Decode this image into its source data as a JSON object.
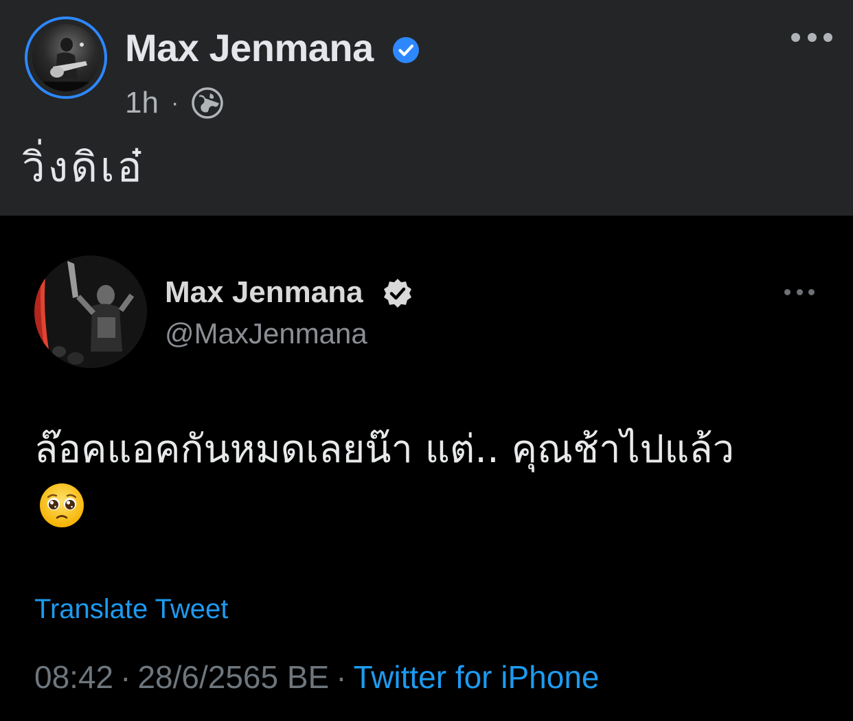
{
  "fb_post": {
    "author_name": "Max Jenmana",
    "time_ago": "1h",
    "separator": "·",
    "caption": "วิ่งดิเอ๋",
    "colors": {
      "background": "#242526",
      "verified": "#2d88ff",
      "avatar_ring": "#2d88ff"
    },
    "icons": {
      "verified": "verified-badge-icon",
      "privacy": "globe-icon",
      "more": "more-options-icon"
    }
  },
  "tweet": {
    "author_name": "Max Jenmana",
    "handle": "@MaxJenmana",
    "text": "ล๊อคแอคกันหมดเลยน๊า แต่.. คุณช้าไปแล้ว",
    "emoji": "pleading-face-icon",
    "translate_label": "Translate Tweet",
    "time": "08:42",
    "date": "28/6/2565 BE",
    "separator": "·",
    "source": "Twitter for iPhone",
    "colors": {
      "background": "#000000",
      "link": "#1d9bf0"
    },
    "icons": {
      "verified": "verified-badge-icon",
      "more": "more-options-icon"
    }
  }
}
